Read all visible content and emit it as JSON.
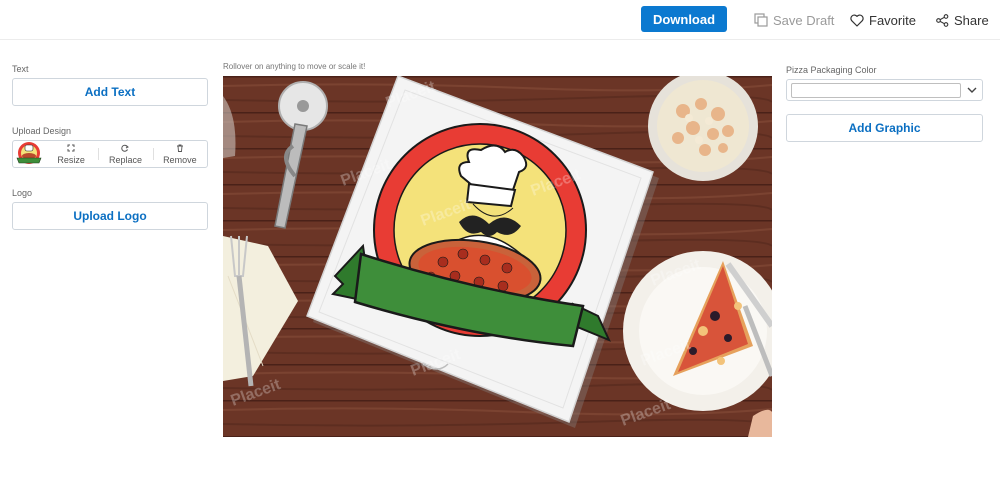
{
  "topbar": {
    "download_label": "Download",
    "save_draft_label": "Save Draft",
    "favorite_label": "Favorite",
    "share_label": "Share"
  },
  "left_panel": {
    "text_section": {
      "label": "Text",
      "button": "Add Text"
    },
    "upload_section": {
      "label": "Upload Design",
      "tools": {
        "resize": "Resize",
        "replace": "Replace",
        "remove": "Remove"
      }
    },
    "logo_section": {
      "label": "Logo",
      "button": "Upload Logo"
    }
  },
  "canvas": {
    "hint": "Rollover on anything to move or scale it!",
    "watermark": "Placeit"
  },
  "right_panel": {
    "color_label": "Pizza Packaging Color",
    "color_value": "#ffffff",
    "add_graphic_label": "Add Graphic"
  },
  "colors": {
    "accent": "#0b79d0",
    "link": "#0b6fc2",
    "logo_red": "#e83c34",
    "logo_yellow": "#f4e27a",
    "banner_green": "#3e8e3a"
  }
}
